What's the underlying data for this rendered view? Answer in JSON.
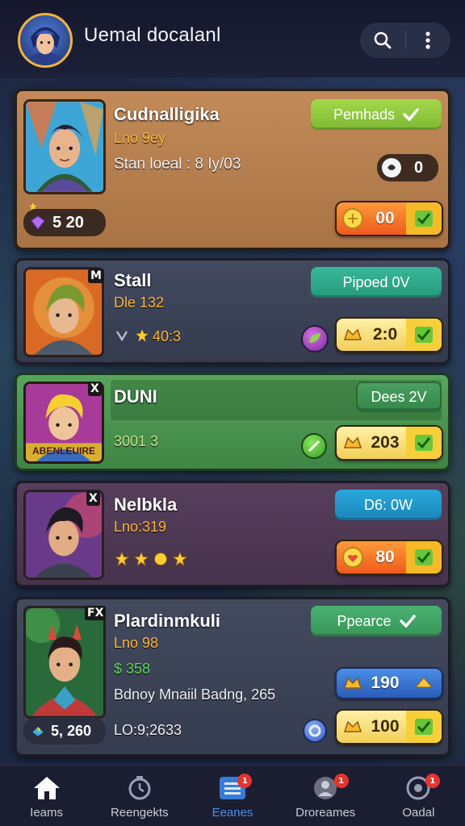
{
  "app": {
    "title": "Uemal docalanl"
  },
  "header": {
    "search_icon": "search-icon",
    "menu_icon": "more-vertical-icon"
  },
  "colors": {
    "card1": "#b9804e",
    "card2": "#3b4256",
    "card3": "#4f9455",
    "card4": "#4e3a52",
    "card5": "#3b4153",
    "green_btn": "#8dc63f",
    "teal_btn": "#2fa58a",
    "blue_btn": "#1e93c8"
  },
  "cards": [
    {
      "name": "Cudnalligika",
      "subtitle": "Lno 9ey",
      "info": "Stan loeal : 8 Iy/03",
      "status_label": "Pemhads",
      "counter_value": "0",
      "gem_value": "5 20",
      "action_value": "00"
    },
    {
      "name": "Stall",
      "rank_tag": "M",
      "subtitle": "Dle 132",
      "stars_text": "40:3",
      "status_label": "Pipoed 0V",
      "action_value": "2:0"
    },
    {
      "name": "DUNI",
      "rank_tag": "X",
      "portrait_banner": "ABENLEUIRE",
      "score": "3001 3",
      "status_label": "Dees 2V",
      "action_value": "203"
    },
    {
      "name": "Nelbkla",
      "rank_tag": "X",
      "subtitle": "Lno:319",
      "status_label": "D6: 0W",
      "action_value": "80"
    },
    {
      "name": "Plardinmkuli",
      "rank_tag": "FX",
      "subtitle": "Lno 98",
      "stat": "$ 358",
      "info": "Bdnoy Mnaiil Badng, 265",
      "bottom_info": "LO:9;2633",
      "gem_value": "5, 260",
      "status_label": "Ppearce",
      "action_value_1": "190",
      "action_value_2": "100"
    }
  ],
  "nav": [
    {
      "label": "Ieams",
      "icon": "home-icon"
    },
    {
      "label": "Reengekts",
      "icon": "timer-icon"
    },
    {
      "label": "Eeanes",
      "icon": "list-icon",
      "badge": "1"
    },
    {
      "label": "Droreames",
      "icon": "profile-icon",
      "badge": "1"
    },
    {
      "label": "Oadal",
      "icon": "settings-icon",
      "badge": "1"
    }
  ]
}
